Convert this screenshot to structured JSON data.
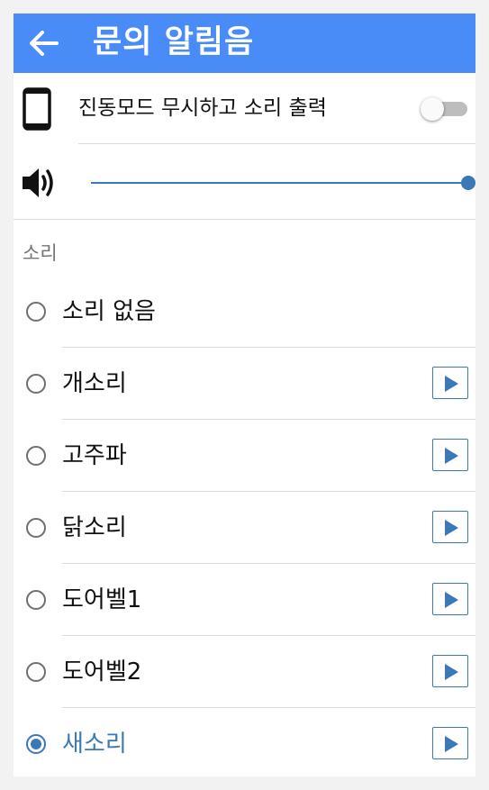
{
  "appbar": {
    "title": "문의 알림음",
    "back_icon": "arrow-left-icon"
  },
  "vibrate": {
    "label": "진동모드 무시하고 소리 출력",
    "enabled": false,
    "icon": "phone-icon"
  },
  "volume": {
    "level_percent": 100,
    "icon": "speaker-icon"
  },
  "sound_section": {
    "header": "소리"
  },
  "sounds": [
    {
      "label": "소리 없음",
      "selected": false,
      "has_play": false
    },
    {
      "label": "개소리",
      "selected": false,
      "has_play": true
    },
    {
      "label": "고주파",
      "selected": false,
      "has_play": true
    },
    {
      "label": "닭소리",
      "selected": false,
      "has_play": true
    },
    {
      "label": "도어벨1",
      "selected": false,
      "has_play": true
    },
    {
      "label": "도어벨2",
      "selected": false,
      "has_play": true
    },
    {
      "label": "새소리",
      "selected": true,
      "has_play": true
    }
  ],
  "colors": {
    "appbar": "#4a8cf7",
    "accent": "#3a78b8"
  }
}
